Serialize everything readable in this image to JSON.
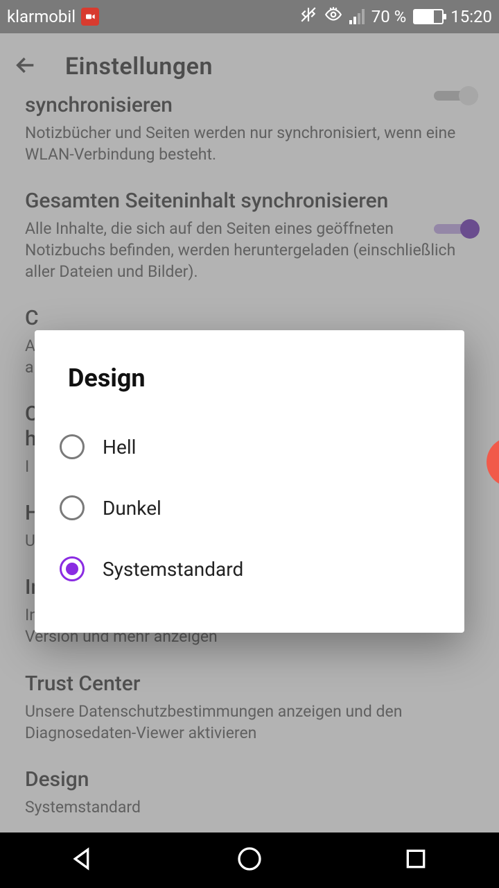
{
  "status": {
    "carrier": "klarmobil",
    "battery_pct": "70 %",
    "clock": "15:20"
  },
  "app_bar": {
    "title": "Einstellungen"
  },
  "settings": {
    "sync_wifi": {
      "title": "synchronisieren",
      "desc": "Notizbücher und Seiten werden nur synchronisiert, wenn eine WLAN-Verbindung besteht."
    },
    "sync_full": {
      "title": "Gesamten Seiteninhalt synchronisieren",
      "desc": "Alle Inhalte, die sich auf den Seiten eines geöffneten Notizbuchs befinden, werden heruntergeladen (einschließlich aller Dateien und Bilder)."
    },
    "item_c1": {
      "title": "C",
      "desc": "A\na"
    },
    "item_c2": {
      "title": "C\nh",
      "desc": "I"
    },
    "item_h": {
      "title": "H",
      "desc": "U"
    },
    "info": {
      "title": "Info",
      "desc": "Informationen zu unseren Nutzungsbedingungen, Ihre App-Version und mehr anzeigen"
    },
    "trust": {
      "title": "Trust Center",
      "desc": "Unsere Datenschutzbestimmungen anzeigen und den Diagnosedaten-Viewer aktivieren"
    },
    "design": {
      "title": "Design",
      "desc": "Systemstandard"
    }
  },
  "dialog": {
    "title": "Design",
    "options": [
      {
        "label": "Hell",
        "selected": false
      },
      {
        "label": "Dunkel",
        "selected": false
      },
      {
        "label": "Systemstandard",
        "selected": true
      }
    ]
  }
}
